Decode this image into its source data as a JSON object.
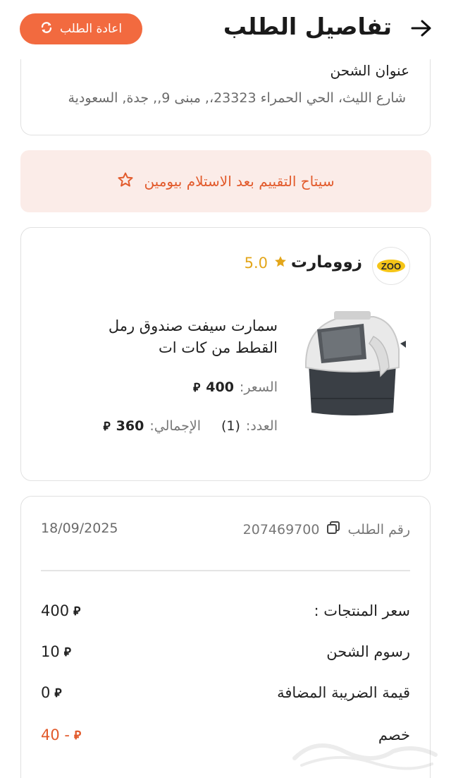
{
  "header": {
    "title": "تفاصيل الطلب",
    "reorder_label": "اعادة الطلب"
  },
  "address": {
    "title": "عنوان الشحن",
    "text": "شارع الليث، الحي الحمراء 23323،, مبنى 9,, جدة, السعودية"
  },
  "notice": {
    "text": "سيتاح التقييم بعد الاستلام بيومين"
  },
  "store": {
    "name": "زوومارت",
    "rating": "5.0",
    "logo_text": "ZOO"
  },
  "product": {
    "name": "سمارت سيفت صندوق رمل القطط من كات ات",
    "price_label": "السعر:",
    "price_value": "400",
    "qty_label": "العدد:",
    "qty_value": "(1)",
    "total_label": "الإجمالي:",
    "total_value": "360"
  },
  "order": {
    "number_label": "رقم الطلب",
    "number": "207469700",
    "date": "18/09/2025"
  },
  "summary": {
    "lines": [
      {
        "label": "سعر المنتجات :",
        "value": "400"
      },
      {
        "label": "رسوم الشحن",
        "value": "10"
      },
      {
        "label": "قيمة الضريبة المضافة",
        "value": "0"
      },
      {
        "label": "خصم",
        "value": "- 40"
      }
    ]
  },
  "colors": {
    "accent": "#f26a3f",
    "notice_bg": "#fbece8",
    "notice_text": "#e25a2b",
    "star": "#e3a61a"
  },
  "icons": {
    "back": "arrow-right-icon",
    "reorder": "refresh-icon",
    "notice": "star-outline-icon",
    "rating": "star-filled-icon",
    "copy": "copy-icon",
    "currency": "riyal-icon"
  }
}
